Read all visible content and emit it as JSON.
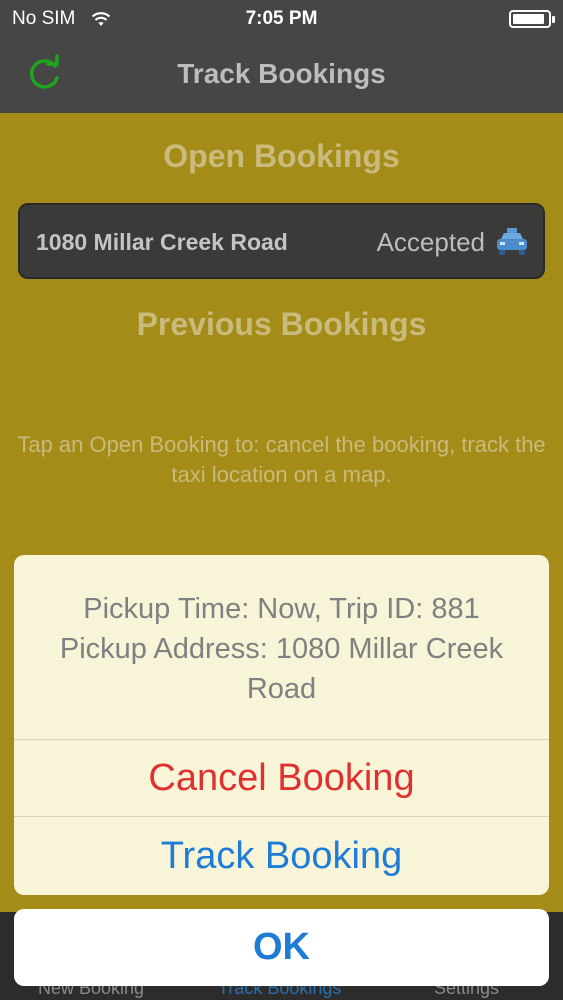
{
  "status_bar": {
    "carrier": "No SIM",
    "time": "7:05 PM",
    "battery_level": 0.9
  },
  "nav": {
    "title": "Track Bookings",
    "refresh_icon": "refresh-icon"
  },
  "sections": {
    "open_title": "Open Bookings",
    "previous_title": "Previous Bookings"
  },
  "open_bookings": [
    {
      "address": "1080 Millar Creek Road",
      "status": "Accepted",
      "icon": "taxi-icon"
    }
  ],
  "hint": "Tap an Open Booking to: cancel the booking, track the taxi location on a map.",
  "tabs": [
    {
      "label": "New Booking",
      "active": false
    },
    {
      "label": "Track Bookings",
      "active": true
    },
    {
      "label": "Settings",
      "active": false
    }
  ],
  "action_sheet": {
    "message_line1": "Pickup Time: Now, Trip ID: 881",
    "message_line2": "Pickup Address: 1080 Millar Creek Road",
    "cancel_label": "Cancel Booking",
    "track_label": "Track Booking",
    "ok_label": "OK"
  },
  "colors": {
    "accent": "#1f7cd6",
    "destructive": "#e03131",
    "refresh": "#1ea51e"
  }
}
